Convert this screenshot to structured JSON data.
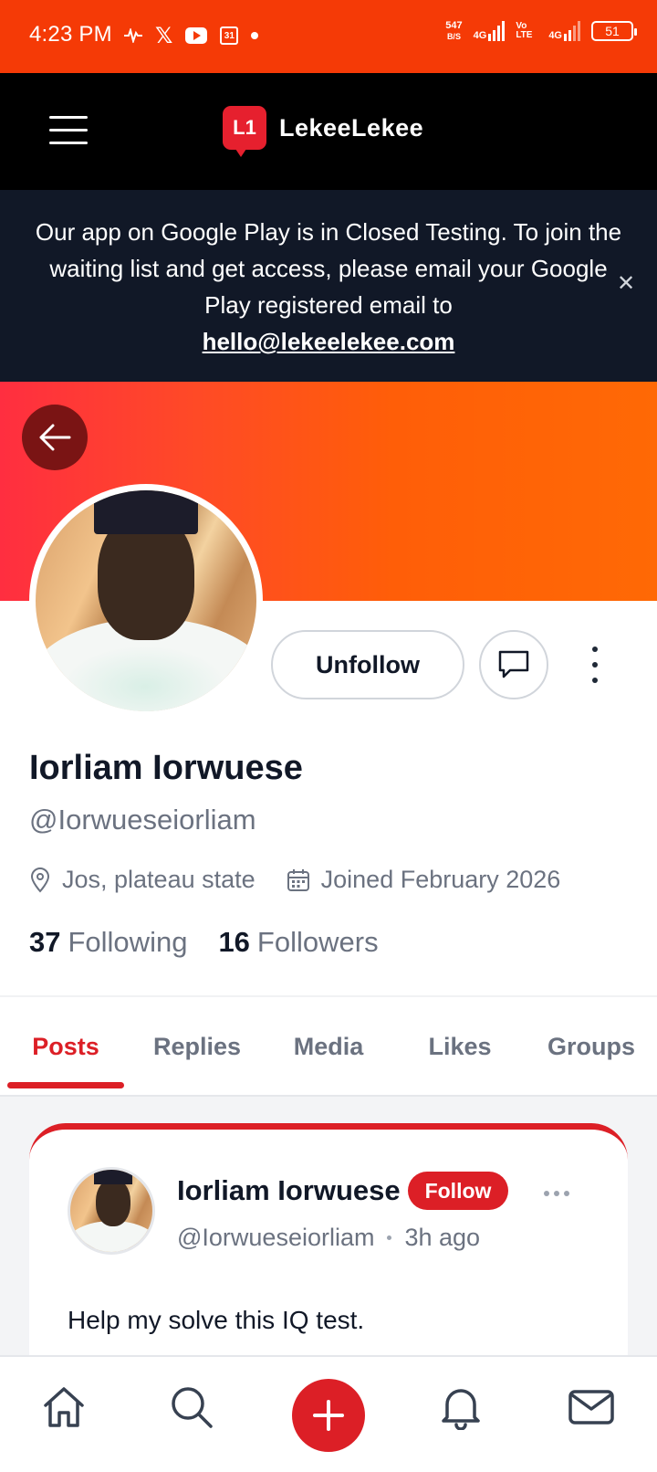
{
  "status_bar": {
    "time": "4:23 PM",
    "net_speed_value": "547",
    "net_speed_unit": "B/S",
    "network1": "4G",
    "volte": "Vo LTE",
    "network2": "4G",
    "battery": "51",
    "notification_icons": [
      "activity-icon",
      "x-icon",
      "youtube-icon",
      "calendar-icon",
      "dot-icon"
    ],
    "calendar_day": "31",
    "x_glyph": "𝕏"
  },
  "header": {
    "logo_mark": "L1",
    "logo_text": "LekeeLekee"
  },
  "banner": {
    "message": "Our app on Google Play is in Closed Testing. To join the waiting list and get access, please email your Google Play registered email to",
    "email": "hello@lekeelekee.com",
    "close_symbol": "✕"
  },
  "profile": {
    "name": "Iorliam Iorwuese",
    "handle": "@Iorwueseiorliam",
    "location": "Jos, plateau state",
    "joined": "Joined February 2026",
    "following_count": "37",
    "following_label": "Following",
    "followers_count": "16",
    "followers_label": "Followers",
    "unfollow_label": "Unfollow"
  },
  "tabs": [
    {
      "label": "Posts",
      "active": true
    },
    {
      "label": "Replies",
      "active": false
    },
    {
      "label": "Media",
      "active": false
    },
    {
      "label": "Likes",
      "active": false
    },
    {
      "label": "Groups",
      "active": false
    }
  ],
  "post": {
    "author": "Iorliam Iorwuese",
    "follow_label": "Follow",
    "handle": "@Iorwueseiorliam",
    "time": "3h ago",
    "text": "Help my solve this IQ test."
  },
  "colors": {
    "status_bar": "#f53a06",
    "accent": "#dc1f26",
    "banner_bg": "#111827",
    "cover_start": "#ff2e40",
    "cover_end": "#ff6905"
  }
}
